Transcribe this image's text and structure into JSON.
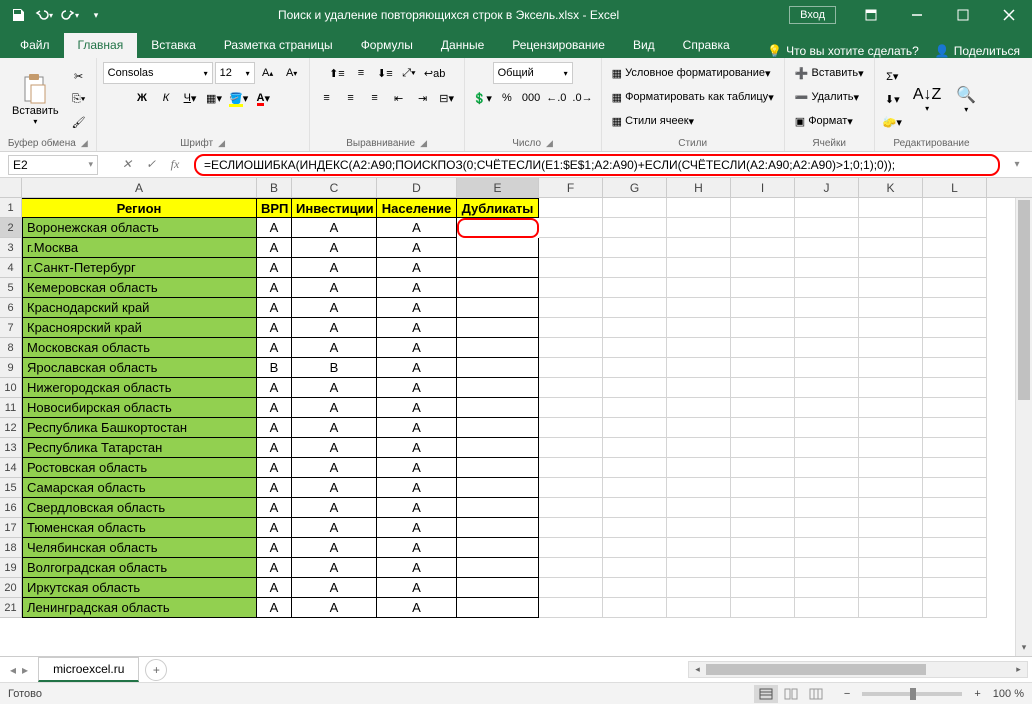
{
  "app": {
    "title": "Поиск и удаление повторяющихся строк в Эксель.xlsx  -  Excel",
    "signin": "Вход"
  },
  "tabs": {
    "file": "Файл",
    "home": "Главная",
    "insert": "Вставка",
    "layout": "Разметка страницы",
    "formulas": "Формулы",
    "data": "Данные",
    "review": "Рецензирование",
    "view": "Вид",
    "help": "Справка"
  },
  "ribbon_right": {
    "tell_me": "Что вы хотите сделать?",
    "share": "Поделиться"
  },
  "ribbon": {
    "clipboard": {
      "label": "Буфер обмена",
      "paste": "Вставить"
    },
    "font": {
      "label": "Шрифт",
      "name": "Consolas",
      "size": "12"
    },
    "alignment": {
      "label": "Выравнивание"
    },
    "number": {
      "label": "Число",
      "format": "Общий"
    },
    "styles": {
      "label": "Стили",
      "conditional": "Условное форматирование",
      "as_table": "Форматировать как таблицу",
      "cell_styles": "Стили ячеек"
    },
    "cells": {
      "label": "Ячейки",
      "insert": "Вставить",
      "delete": "Удалить",
      "format": "Формат"
    },
    "editing": {
      "label": "Редактирование"
    }
  },
  "namebox": "E2",
  "formula": "=ЕСЛИОШИБКА(ИНДЕКС(A2:A90;ПОИСКПОЗ(0;СЧЁТЕСЛИ(E1:$E$1;A2:A90)+ЕСЛИ(СЧЁТЕСЛИ(A2:A90;A2:A90)>1;0;1);0));",
  "columns": {
    "A": 235,
    "B": 35,
    "C": 85,
    "D": 80,
    "E": 82,
    "F": 64,
    "G": 64,
    "H": 64,
    "I": 64,
    "J": 64,
    "K": 64,
    "L": 64
  },
  "headers": [
    "Регион",
    "ВРП",
    "Инвестиции",
    "Население",
    "Дубликаты"
  ],
  "rows": [
    {
      "n": 2,
      "region": "Воронежская область",
      "b": "A",
      "c": "A",
      "d": "A"
    },
    {
      "n": 3,
      "region": "г.Москва",
      "b": "A",
      "c": "A",
      "d": "A"
    },
    {
      "n": 4,
      "region": "г.Санкт-Петербург",
      "b": "A",
      "c": "A",
      "d": "A"
    },
    {
      "n": 5,
      "region": "Кемеровская область",
      "b": "A",
      "c": "A",
      "d": "A"
    },
    {
      "n": 6,
      "region": "Краснодарский край",
      "b": "A",
      "c": "A",
      "d": "A"
    },
    {
      "n": 7,
      "region": "Красноярский край",
      "b": "A",
      "c": "A",
      "d": "A"
    },
    {
      "n": 8,
      "region": "Московская область",
      "b": "A",
      "c": "A",
      "d": "A"
    },
    {
      "n": 9,
      "region": "Ярославская область",
      "b": "B",
      "c": "B",
      "d": "A"
    },
    {
      "n": 10,
      "region": "Нижегородская область",
      "b": "A",
      "c": "A",
      "d": "A"
    },
    {
      "n": 11,
      "region": "Новосибирская область",
      "b": "A",
      "c": "A",
      "d": "A"
    },
    {
      "n": 12,
      "region": "Республика Башкортостан",
      "b": "A",
      "c": "A",
      "d": "A"
    },
    {
      "n": 13,
      "region": "Республика Татарстан",
      "b": "A",
      "c": "A",
      "d": "A"
    },
    {
      "n": 14,
      "region": "Ростовская область",
      "b": "A",
      "c": "A",
      "d": "A"
    },
    {
      "n": 15,
      "region": "Самарская область",
      "b": "A",
      "c": "A",
      "d": "A"
    },
    {
      "n": 16,
      "region": "Свердловская область",
      "b": "A",
      "c": "A",
      "d": "A"
    },
    {
      "n": 17,
      "region": "Тюменская область",
      "b": "A",
      "c": "A",
      "d": "A"
    },
    {
      "n": 18,
      "region": "Челябинская область",
      "b": "A",
      "c": "A",
      "d": "A"
    },
    {
      "n": 19,
      "region": "Волгоградская область",
      "b": "A",
      "c": "A",
      "d": "A"
    },
    {
      "n": 20,
      "region": "Иркутская область",
      "b": "A",
      "c": "A",
      "d": "A"
    },
    {
      "n": 21,
      "region": "Ленинградская область",
      "b": "A",
      "c": "A",
      "d": "A"
    }
  ],
  "sheet": {
    "name": "microexcel.ru"
  },
  "status": {
    "ready": "Готово",
    "zoom": "100 %"
  }
}
